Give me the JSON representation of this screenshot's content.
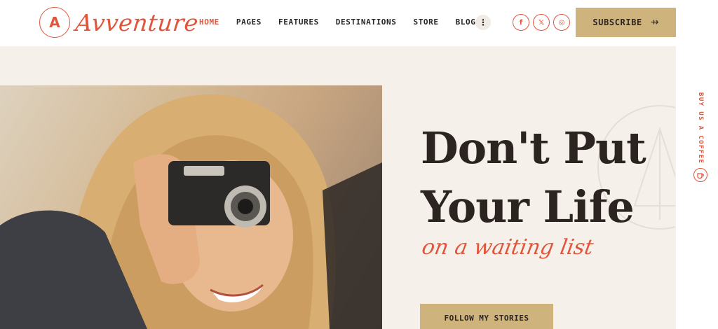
{
  "brand": {
    "badge": "A",
    "name": "Avventure"
  },
  "nav": {
    "items": [
      {
        "label": "HOME",
        "active": true
      },
      {
        "label": "PAGES",
        "active": false
      },
      {
        "label": "FEATURES",
        "active": false
      },
      {
        "label": "DESTINATIONS",
        "active": false
      },
      {
        "label": "STORE",
        "active": false
      },
      {
        "label": "BLOG",
        "active": false
      }
    ],
    "more_glyph": "⋮"
  },
  "socials": [
    {
      "icon": "facebook-icon",
      "glyph": "f"
    },
    {
      "icon": "x-icon",
      "glyph": "𝕏"
    },
    {
      "icon": "instagram-icon",
      "glyph": "◎"
    }
  ],
  "subscribe": {
    "label": "SUBSCRIBE",
    "arrow": "⇸"
  },
  "hero": {
    "headline_line1": "Don't Put",
    "headline_line2": "Your Life",
    "script": "on a waiting list",
    "cta_label": "FOLLOW MY STORIES"
  },
  "side": {
    "coffee_label": "BUY US A COFFEE"
  },
  "colors": {
    "accent": "#e0553c",
    "gold": "#cfb37c",
    "cream": "#f5f1ea",
    "ink": "#2a2522"
  }
}
